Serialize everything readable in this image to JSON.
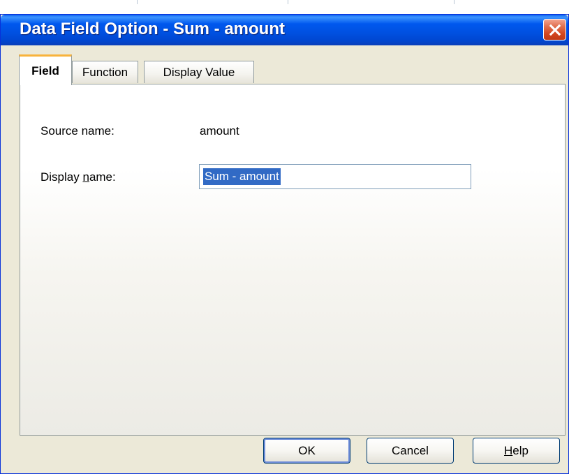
{
  "dialog": {
    "title": "Data Field Option - Sum - amount",
    "close_icon": "close-x-icon"
  },
  "tabs": [
    {
      "label": "Field",
      "active": true
    },
    {
      "label": "Function",
      "active": false
    },
    {
      "label": "Display Value",
      "active": false
    }
  ],
  "field_tab": {
    "source_name_label": "Source name:",
    "source_name_value": "amount",
    "display_name_label_pre": "Display ",
    "display_name_label_accel": "n",
    "display_name_label_post": "ame:",
    "display_name_value": "Sum - amount"
  },
  "buttons": {
    "ok_label": "OK",
    "cancel_label": "Cancel",
    "help_label_accel": "H",
    "help_label_post": "elp"
  },
  "colors": {
    "title_bar": "#0058ee",
    "dialog_bg": "#ece9d8",
    "active_tab_accent": "#f8b33c",
    "selection": "#316ac5",
    "close_button": "#d3461f"
  }
}
